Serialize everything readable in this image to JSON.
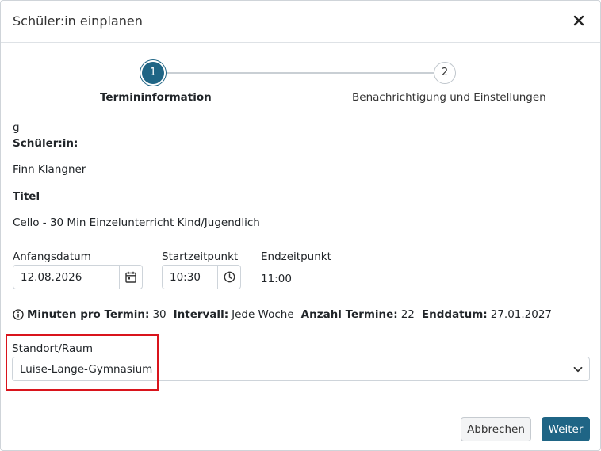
{
  "dialog": {
    "title": "Schüler:in einplanen"
  },
  "stepper": {
    "steps": [
      {
        "number": "1",
        "label": "Termininformation",
        "active": true
      },
      {
        "number": "2",
        "label": "Benachrichtigung und Einstellungen",
        "active": false
      }
    ]
  },
  "form": {
    "stray_text": "g",
    "student_label": "Schüler:in:",
    "student_value": "Finn Klangner",
    "title_label": "Titel",
    "title_value": "Cello - 30 Min Einzelunterricht Kind/Jugendlich",
    "start_date_label": "Anfangsdatum",
    "start_date_value": "12.08.2026",
    "start_time_label": "Startzeitpunkt",
    "start_time_value": "10:30",
    "end_time_label": "Endzeitpunkt",
    "end_time_value": "11:00"
  },
  "info": {
    "minutes_label": "Minuten pro Termin:",
    "minutes_value": "30",
    "interval_label": "Intervall:",
    "interval_value": "Jede Woche",
    "count_label": "Anzahl Termine:",
    "count_value": "22",
    "end_date_label": "Enddatum:",
    "end_date_value": "27.01.2027"
  },
  "location": {
    "label": "Standort/Raum",
    "selected": "Luise-Lange-Gymnasium"
  },
  "buttons": {
    "cancel": "Abbrechen",
    "next": "Weiter"
  },
  "colors": {
    "primary": "#1f6585",
    "highlight": "#d9141c"
  }
}
